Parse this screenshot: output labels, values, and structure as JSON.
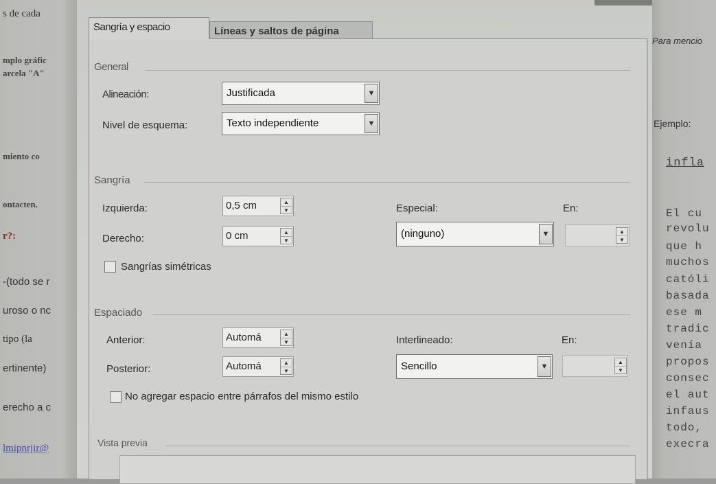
{
  "background_left": {
    "lines": [
      "s de cada",
      "mplo gráfic",
      "arcela \"A\"",
      "miento co",
      "ontacten.",
      "r?:",
      "-(todo se r",
      "uroso o nc",
      "tipo  (la",
      "ertinente)",
      "erecho a c",
      "lmipnrjir@"
    ]
  },
  "background_right": {
    "lines": [
      "Para mencio",
      "Ejemplo:",
      "infla",
      "El  cu",
      "revolu",
      "que  h",
      "muchos",
      "católi",
      "basada",
      "ese  m",
      "tradic",
      "venía",
      "propos",
      "consec",
      "el aut",
      "infaus",
      "todo,",
      "execra"
    ]
  },
  "dialog": {
    "tabs": [
      "Sangría y espacio",
      "Líneas y saltos de página"
    ],
    "general": {
      "section_label": "General",
      "alignment_label": "Alineación:",
      "alignment_value": "Justificada",
      "outline_label": "Nivel de esquema:",
      "outline_value": "Texto independiente"
    },
    "indent": {
      "section_label": "Sangría",
      "left_label": "Izquierda:",
      "left_value": "0,5 cm",
      "right_label": "Derecho:",
      "right_value": "0 cm",
      "special_label": "Especial:",
      "special_value": "(ninguno)",
      "by_label": "En:",
      "mirror_label": "Sangrías simétricas"
    },
    "spacing": {
      "section_label": "Espaciado",
      "before_label": "Anterior:",
      "before_value": "Automá",
      "after_label": "Posterior:",
      "after_value": "Automá",
      "line_spacing_label": "Interlineado:",
      "line_spacing_value": "Sencillo",
      "at_label": "En:",
      "no_space_label": "No agregar espacio entre párrafos del mismo estilo"
    },
    "preview": {
      "section_label": "Vista previa"
    }
  }
}
